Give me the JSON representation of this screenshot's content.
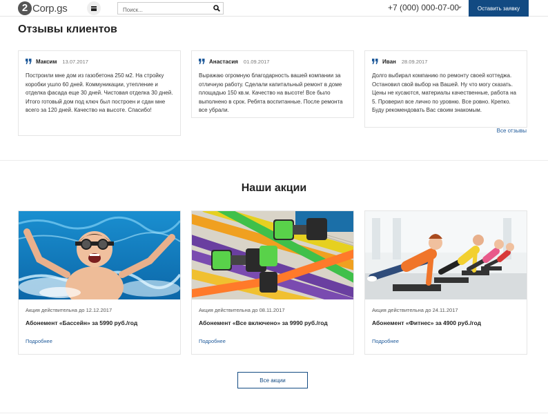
{
  "header": {
    "logo_mark": "2",
    "logo_text": "Corp.gs",
    "search_placeholder": "Поиск...",
    "phone": "+7 (000) 000-07-00",
    "order_button": "Оставить заявку"
  },
  "reviews": {
    "title": "Отзывы клиентов",
    "items": [
      {
        "name": "Максим",
        "date": "13.07.2017",
        "text": "Построили мне дом из газобетона 250 м2. На стройку коробки ушло 60 дней. Коммуникации, утепление и отделка фасада еще 30 дней. Чистовая отделка 30 дней. Итого готовый дом под ключ был построен и сдан мне всего за 120 дней. Качество на высоте. Спасибо!"
      },
      {
        "name": "Анастасия",
        "date": "01.09.2017",
        "text": "Выражаю огромную благодарность вашей компании за отличную работу. Сделали капитальный ремонт в доме площадью 150 кв.м. Качество на высоте! Все было выполнено в срок. Ребята воспитанные. После ремонта все убрали."
      },
      {
        "name": "Иван",
        "date": "28.09.2017",
        "text": "Долго выбирал компанию по ремонту своей коттеджа. Остановил свой выбор на Вашей. Ну что могу сказать. Цены не кусаются, материалы качественные, работа на 5. Проверил все лично по уровню. Все ровно. Крепко. Буду рекомендовать Вас своим знакомым."
      }
    ],
    "all_link": "Все отзывы"
  },
  "promotions": {
    "title": "Наши акции",
    "items": [
      {
        "validity": "Акция действительна до 12.12.2017",
        "name": "Абонемент «Бассейн» за 5990 руб./год",
        "more": "Подробнее",
        "image": "pool-boy-photo"
      },
      {
        "validity": "Акция действительна до 08.11.2017",
        "name": "Абонемент «Все включено» за 9990 руб./год",
        "more": "Подробнее",
        "image": "pool-noodles-photo"
      },
      {
        "validity": "Акция действительна до 24.11.2017",
        "name": "Абонемент «Фитнес» за 4900 руб./год",
        "more": "Подробнее",
        "image": "fitness-kids-photo"
      }
    ],
    "all_button": "Все акции"
  },
  "colors": {
    "brand": "#124a82",
    "link": "#1f5a9a"
  }
}
